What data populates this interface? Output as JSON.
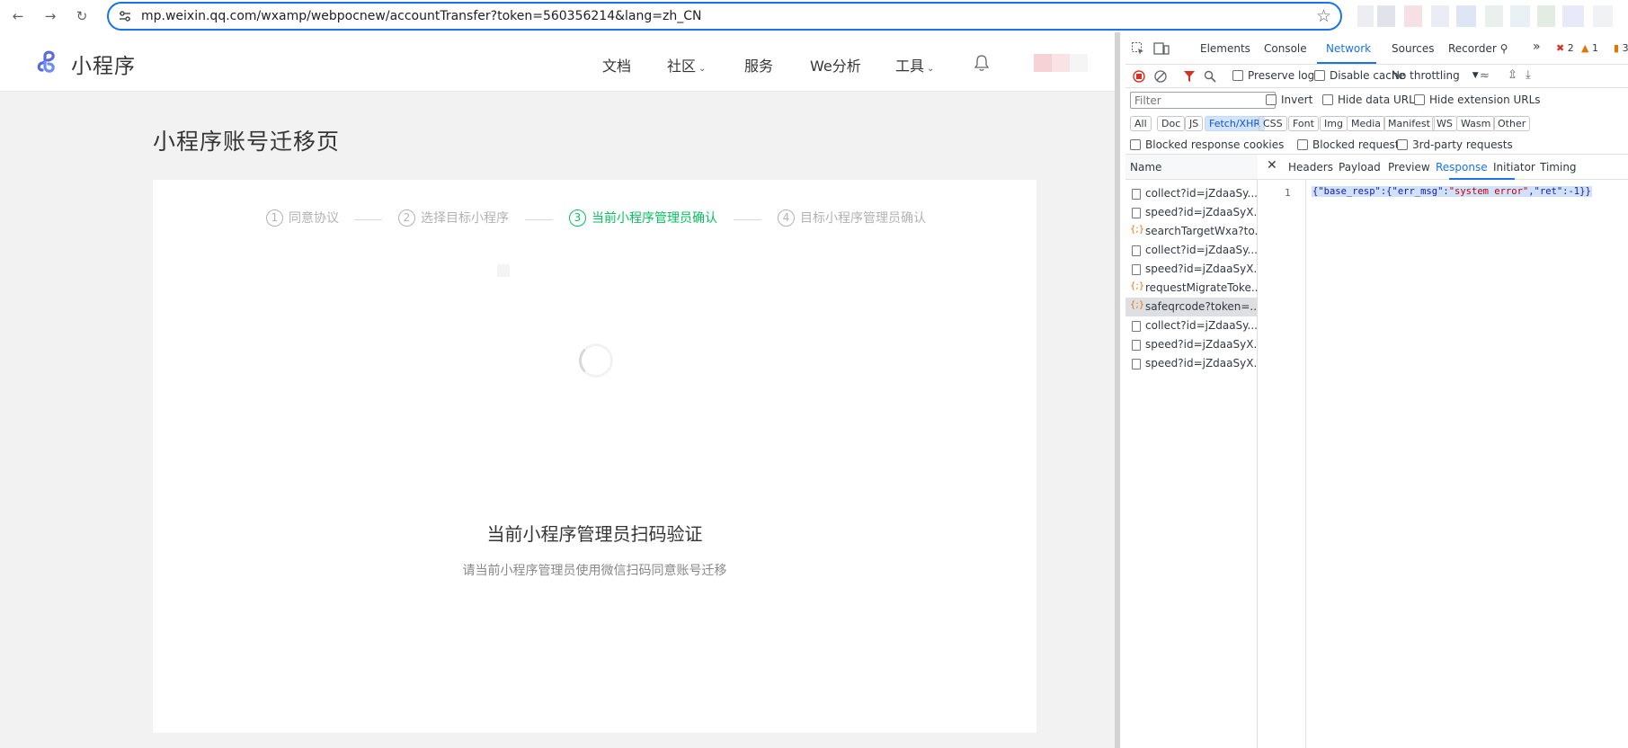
{
  "browser": {
    "url": "mp.weixin.qq.com/wxamp/webpocnew/accountTransfer?token=560356214&lang=zh_CN"
  },
  "header": {
    "logo_text": "小程序",
    "menu": [
      {
        "label": "文档",
        "dropdown": false
      },
      {
        "label": "社区",
        "dropdown": true
      },
      {
        "label": "服务",
        "dropdown": false
      },
      {
        "label": "We分析",
        "dropdown": false
      },
      {
        "label": "工具",
        "dropdown": true
      }
    ]
  },
  "page": {
    "title": "小程序账号迁移页",
    "steps": [
      {
        "num": "1",
        "label": "同意协议",
        "active": false
      },
      {
        "num": "2",
        "label": "选择目标小程序",
        "active": false
      },
      {
        "num": "3",
        "label": "当前小程序管理员确认",
        "active": true
      },
      {
        "num": "4",
        "label": "目标小程序管理员确认",
        "active": false
      }
    ],
    "qr_title": "当前小程序管理员扫码验证",
    "qr_desc": "请当前小程序管理员使用微信扫码同意账号迁移"
  },
  "devtools": {
    "tabs": [
      "Elements",
      "Console",
      "Network",
      "Sources",
      "Recorder"
    ],
    "active_tab": "Network",
    "errors": "2",
    "warnings": "1",
    "issues": "3",
    "toolbar": {
      "preserve_log": "Preserve log",
      "disable_cache": "Disable cache",
      "throttling": "No throttling"
    },
    "filter_placeholder": "Filter",
    "filter_options": {
      "invert": "Invert",
      "hide_data": "Hide data URLs",
      "hide_ext": "Hide extension URLs"
    },
    "types": [
      "All",
      "Doc",
      "JS",
      "Fetch/XHR",
      "CSS",
      "Font",
      "Img",
      "Media",
      "Manifest",
      "WS",
      "Wasm",
      "Other"
    ],
    "active_type": "Fetch/XHR",
    "blocked": {
      "cookies": "Blocked response cookies",
      "requests": "Blocked requests",
      "third_party": "3rd-party requests"
    },
    "name_header": "Name",
    "requests": [
      {
        "name": "collect?id=jZdaaSy...",
        "type": "doc"
      },
      {
        "name": "speed?id=jZdaaSyX...",
        "type": "doc"
      },
      {
        "name": "searchTargetWxa?to...",
        "type": "xhr"
      },
      {
        "name": "collect?id=jZdaaSy...",
        "type": "doc"
      },
      {
        "name": "speed?id=jZdaaSyX...",
        "type": "doc"
      },
      {
        "name": "requestMigrateToke...",
        "type": "xhr"
      },
      {
        "name": "safeqrcode?token=...",
        "type": "xhr",
        "selected": true
      },
      {
        "name": "collect?id=jZdaaSy...",
        "type": "doc"
      },
      {
        "name": "speed?id=jZdaaSyX...",
        "type": "doc"
      },
      {
        "name": "speed?id=jZdaaSyX...",
        "type": "doc"
      }
    ],
    "detail_tabs": [
      "Headers",
      "Payload",
      "Preview",
      "Response",
      "Initiator",
      "Timing"
    ],
    "active_detail_tab": "Response",
    "response": {
      "line": "1",
      "prefix": "{\"base_resp\":{\"err_msg\":",
      "err_msg": "\"system error\"",
      "suffix": ",\"ret\":-1}}"
    }
  }
}
